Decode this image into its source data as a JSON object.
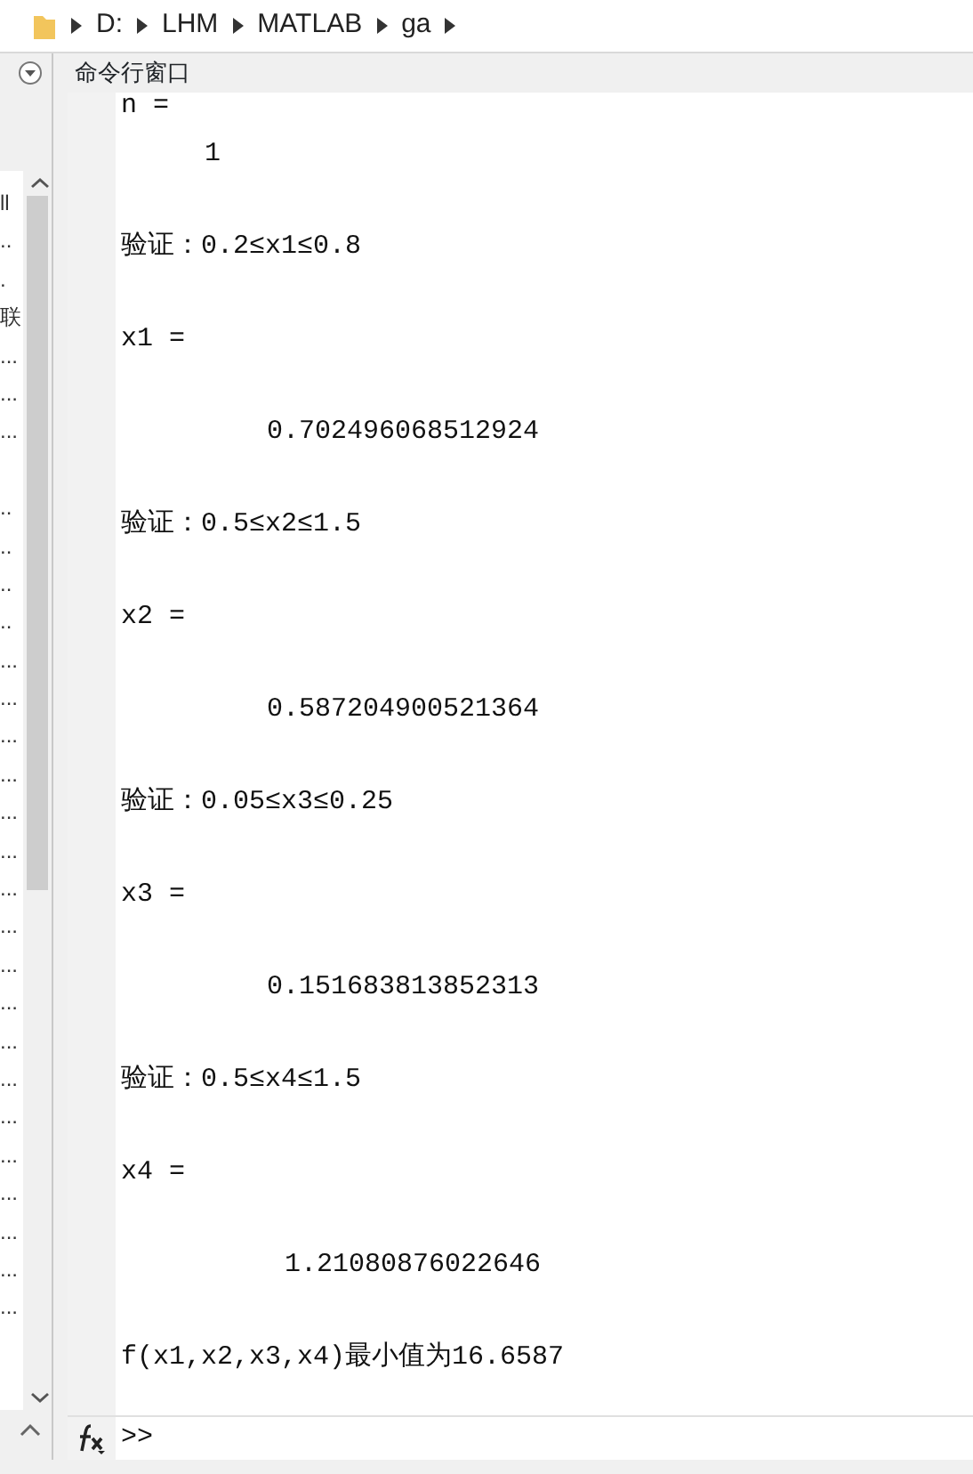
{
  "address_bar": {
    "segments": [
      "D:",
      "LHM",
      "MATLAB",
      "ga"
    ]
  },
  "left_panel": {
    "items": [
      {
        "kind": "text",
        "text": "ll"
      },
      {
        "kind": "text",
        "text": ".."
      },
      {
        "kind": "text",
        "text": "."
      },
      {
        "kind": "text",
        "text": "联"
      },
      {
        "kind": "text",
        "text": "..."
      },
      {
        "kind": "text",
        "text": "..."
      },
      {
        "kind": "text",
        "text": "..."
      },
      {
        "kind": "gap"
      },
      {
        "kind": "text",
        "text": ".."
      },
      {
        "kind": "text",
        "text": ".."
      },
      {
        "kind": "text",
        "text": ".."
      },
      {
        "kind": "text",
        "text": ".."
      },
      {
        "kind": "text",
        "text": "..."
      },
      {
        "kind": "text",
        "text": "..."
      },
      {
        "kind": "text",
        "text": "..."
      },
      {
        "kind": "text",
        "text": "..."
      },
      {
        "kind": "text",
        "text": "..."
      },
      {
        "kind": "text",
        "text": "..."
      },
      {
        "kind": "text",
        "text": "..."
      },
      {
        "kind": "text",
        "text": "..."
      },
      {
        "kind": "text",
        "text": "..."
      },
      {
        "kind": "text",
        "text": "..."
      },
      {
        "kind": "text",
        "text": "..."
      },
      {
        "kind": "text",
        "text": "..."
      },
      {
        "kind": "text",
        "text": "..."
      },
      {
        "kind": "text",
        "text": "..."
      },
      {
        "kind": "text",
        "text": "..."
      },
      {
        "kind": "text",
        "text": "..."
      },
      {
        "kind": "text",
        "text": "..."
      },
      {
        "kind": "text",
        "text": "..."
      }
    ]
  },
  "command_window": {
    "title": "命令行窗口",
    "lines": [
      {
        "kind": "label",
        "text": "n ="
      },
      {
        "kind": "int",
        "text": "1"
      },
      {
        "kind": "label",
        "text": "验证：0.2≤x1≤0.8"
      },
      {
        "kind": "label",
        "text": "x1 ="
      },
      {
        "kind": "frac",
        "text": "0.702496068512924"
      },
      {
        "kind": "label",
        "text": "验证：0.5≤x2≤1.5"
      },
      {
        "kind": "label",
        "text": "x2 ="
      },
      {
        "kind": "frac",
        "text": "0.587204900521364"
      },
      {
        "kind": "label",
        "text": "验证：0.05≤x3≤0.25"
      },
      {
        "kind": "label",
        "text": "x3 ="
      },
      {
        "kind": "frac",
        "text": "0.151683813852313"
      },
      {
        "kind": "label",
        "text": "验证：0.5≤x4≤1.5"
      },
      {
        "kind": "label",
        "text": "x4 ="
      },
      {
        "kind": "num",
        "text": "1.21080876022646"
      },
      {
        "kind": "label",
        "text": "f(x1,x2,x3,x4)最小值为16.6587"
      }
    ],
    "prompt": ">>"
  }
}
